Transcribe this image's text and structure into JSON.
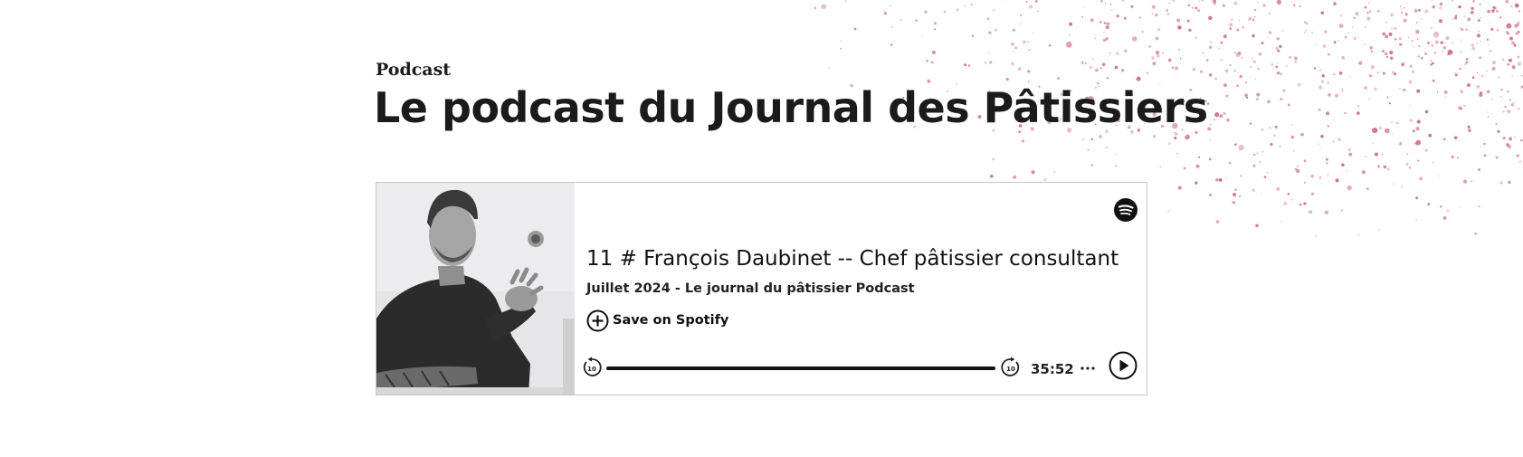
{
  "section_label": "Podcast",
  "page_title": "Le podcast du Journal des Pâtissiers",
  "player": {
    "episode_title": "11 # François Daubinet -- Chef pâtissier consultant",
    "episode_subtitle": "Juillet 2024 - Le journal du pâtissier Podcast",
    "save_label": "Save on Spotify",
    "duration": "35:52",
    "progress_fraction": 1.0,
    "skip_back_seconds": "10",
    "skip_forward_seconds": "10",
    "icons": {
      "brand": "spotify-icon",
      "save": "plus-circle-icon",
      "skip_back": "rewind-10-icon",
      "skip_forward": "forward-10-icon",
      "more": "more-dots-icon",
      "play": "play-icon"
    }
  },
  "colors": {
    "splatter": "#c8698f",
    "text": "#1a1a1a",
    "player_border": "#c7c7c7"
  }
}
